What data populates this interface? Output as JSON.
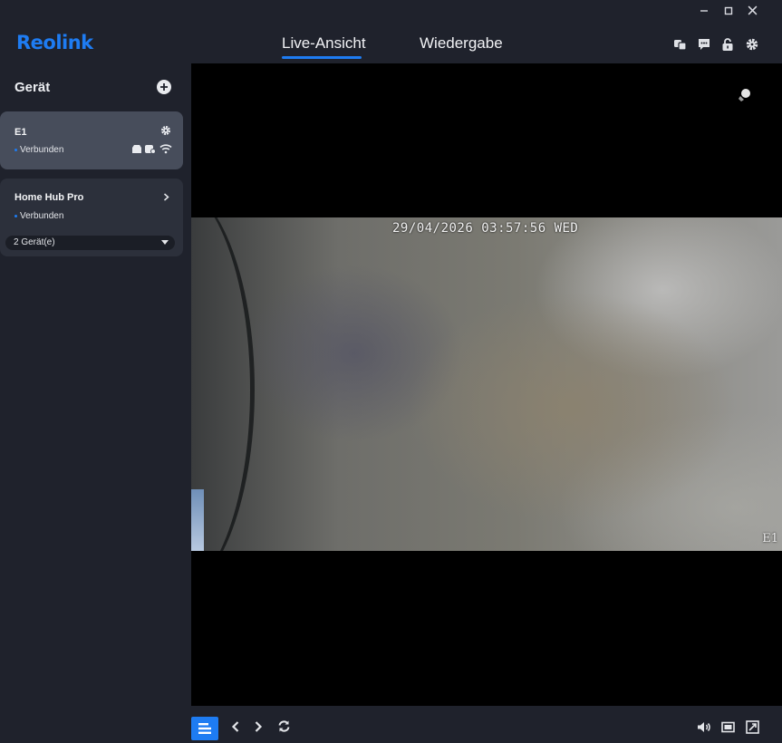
{
  "window": {
    "minimize": "—",
    "maximize": "☐",
    "close": "✕"
  },
  "header": {
    "logo": "Reolink",
    "tabs": [
      {
        "label": "Live-Ansicht",
        "active": true
      },
      {
        "label": "Wiedergabe",
        "active": false
      }
    ],
    "icons": [
      "devices-icon",
      "message-icon",
      "lock-icon",
      "settings-icon"
    ]
  },
  "sidebar": {
    "title": "Gerät",
    "devices": [
      {
        "name": "E1",
        "status": "Verbunden",
        "selected": true
      },
      {
        "name": "Home Hub Pro",
        "status": "Verbunden",
        "selected": false,
        "subdevices": "2 Gerät(e)"
      }
    ]
  },
  "video": {
    "osd_time": "29/04/2026 03:57:56 WED",
    "osd_name": "E1"
  },
  "colors": {
    "accent": "#1e7cf2",
    "background": "#1f222c",
    "selected_card": "#474d5b",
    "card": "#2c303b"
  }
}
